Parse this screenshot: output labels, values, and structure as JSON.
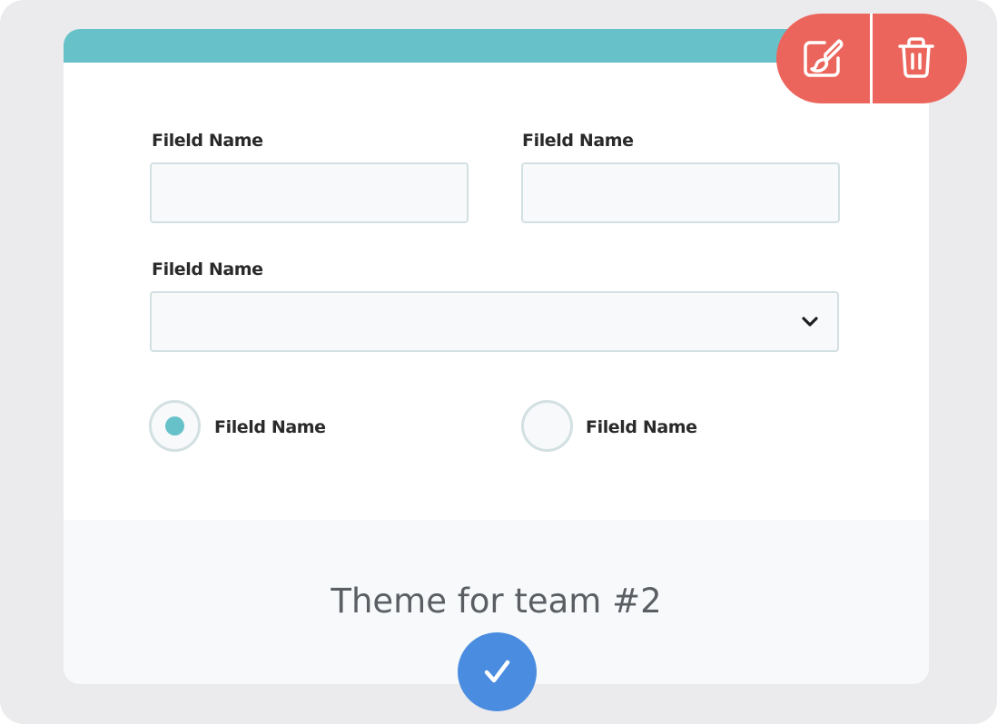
{
  "form": {
    "field1_label": "Fileld Name",
    "field2_label": "Fileld Name",
    "field3_label": "Fileld Name",
    "radio1_label": "Fileld Name",
    "radio2_label": "Fileld Name",
    "radio1_selected": true,
    "radio2_selected": false
  },
  "theme": {
    "title": "Theme for team #2",
    "selected": true
  },
  "actions": {
    "edit_icon": "paintbrush-icon",
    "delete_icon": "trash-icon"
  },
  "colors": {
    "accent_teal": "#66c1c8",
    "action_red": "#ec655c",
    "confirm_blue": "#4a8de0"
  }
}
